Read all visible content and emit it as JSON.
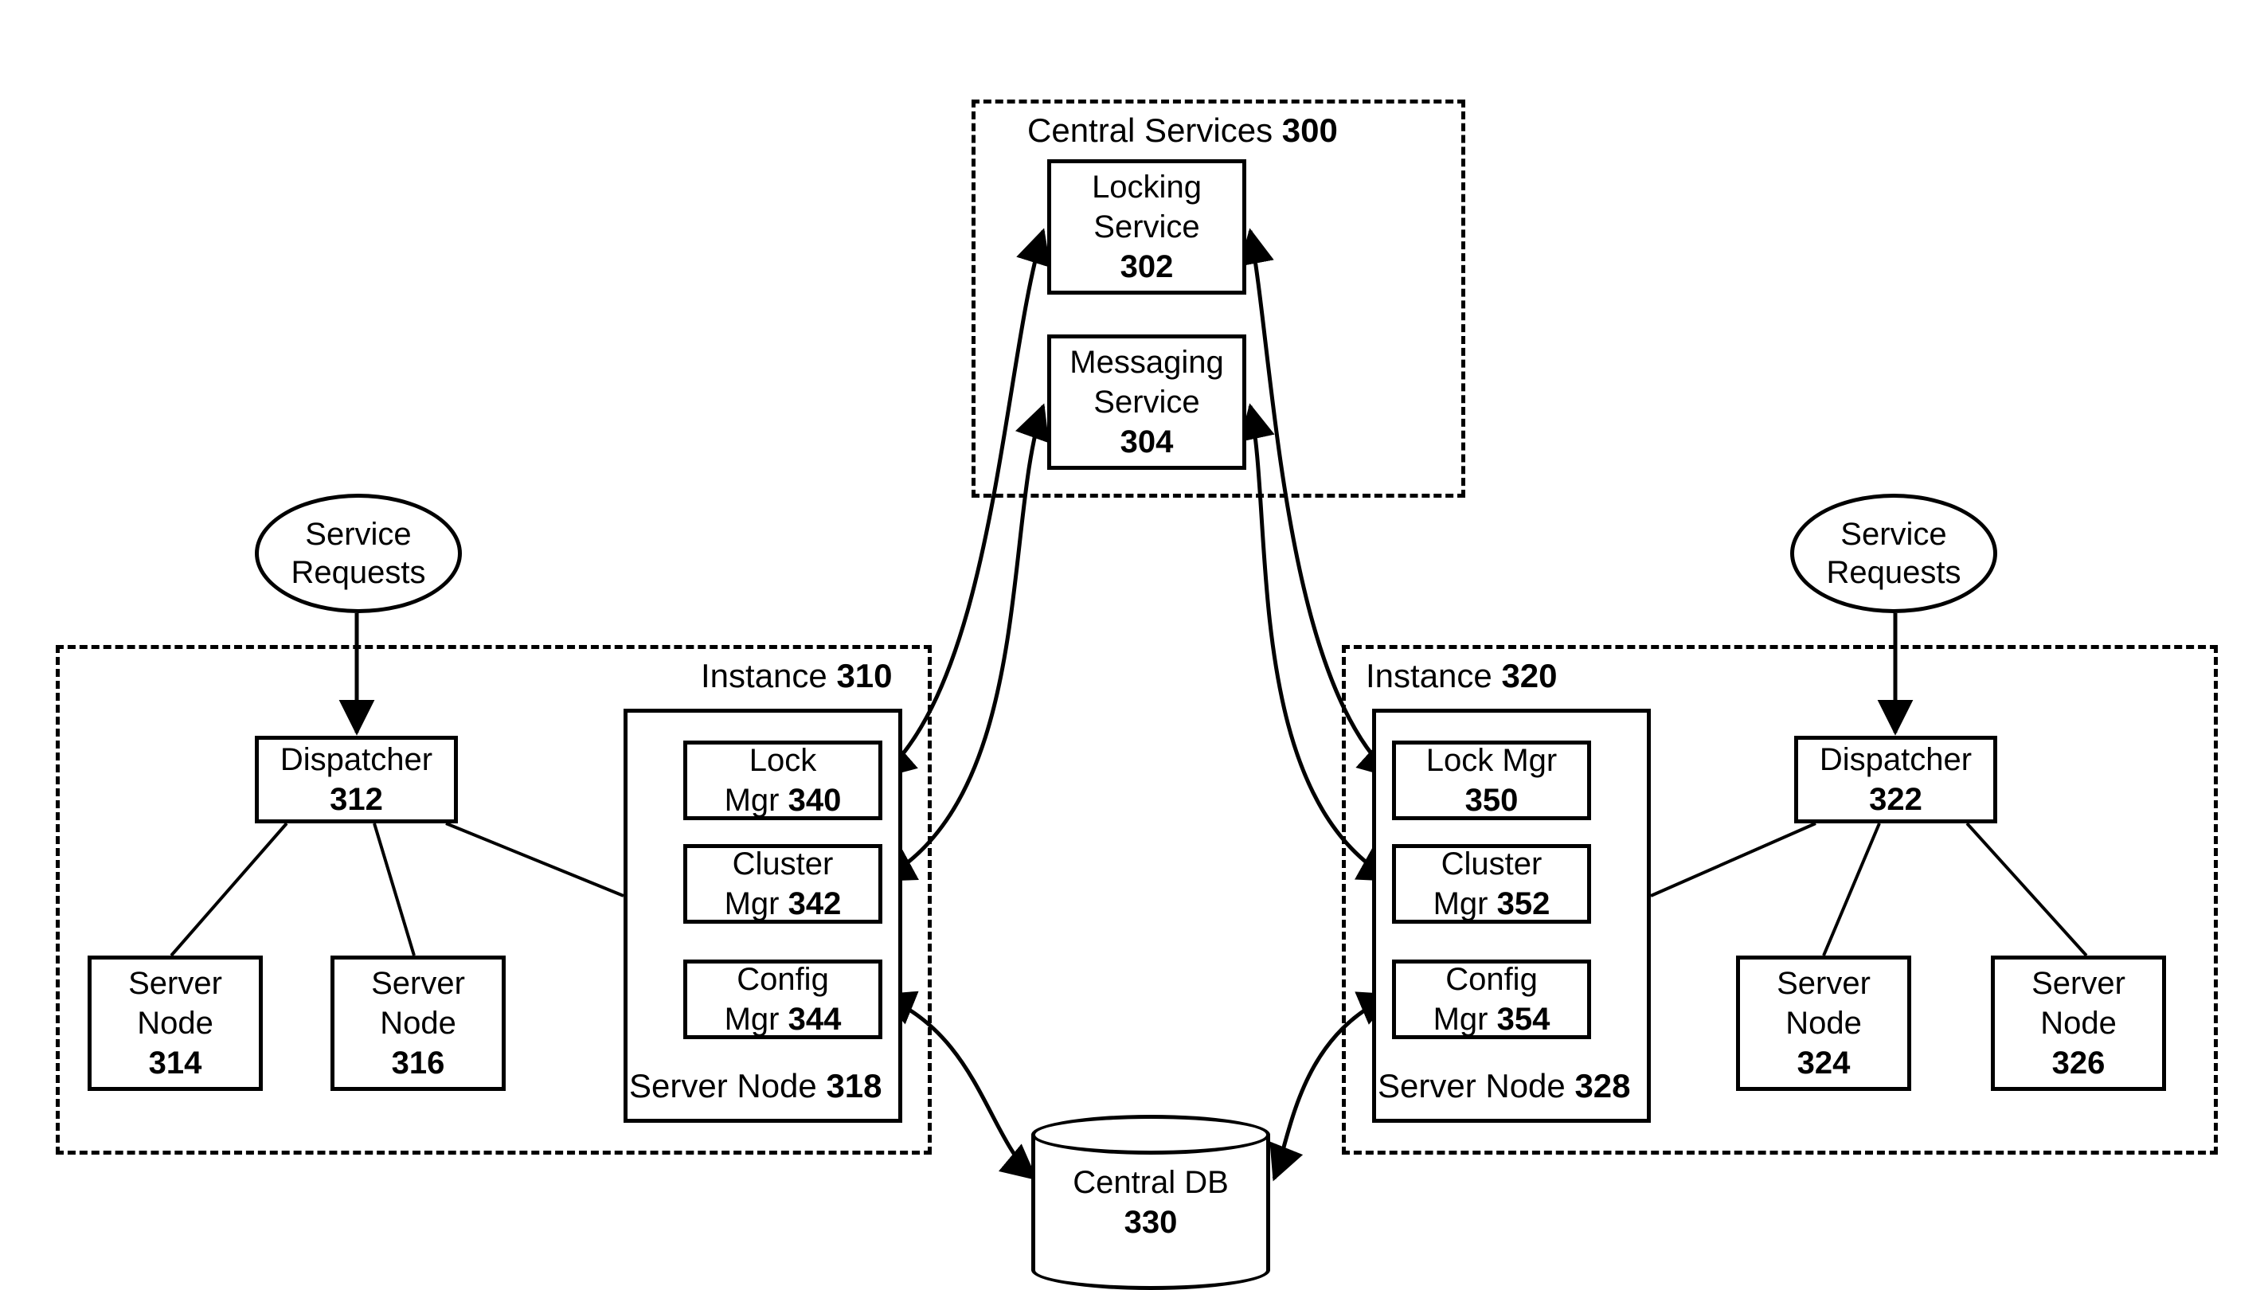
{
  "central": {
    "title_label": "Central Services",
    "title_num": "300",
    "locking": {
      "l1": "Locking",
      "l2": "Service",
      "num": "302"
    },
    "messaging": {
      "l1": "Messaging",
      "l2": "Service",
      "num": "304"
    }
  },
  "left": {
    "instance_label": "Instance",
    "instance_num": "310",
    "requests_l1": "Service",
    "requests_l2": "Requests",
    "dispatcher": {
      "label": "Dispatcher",
      "num": "312"
    },
    "sn1": {
      "l1": "Server",
      "l2": "Node",
      "num": "314"
    },
    "sn2": {
      "l1": "Server",
      "l2": "Node",
      "num": "316"
    },
    "sn_mgr_title_label": "Server Node",
    "sn_mgr_title_num": "318",
    "lock": {
      "l1": "Lock",
      "l2_label": "Mgr",
      "l2_num": "340"
    },
    "cluster": {
      "l1": "Cluster",
      "l2_label": "Mgr",
      "l2_num": "342"
    },
    "config": {
      "l1": "Config",
      "l2_label": "Mgr",
      "l2_num": "344"
    }
  },
  "right": {
    "instance_label": "Instance",
    "instance_num": "320",
    "requests_l1": "Service",
    "requests_l2": "Requests",
    "dispatcher": {
      "label": "Dispatcher",
      "num": "322"
    },
    "sn1": {
      "l1": "Server",
      "l2": "Node",
      "num": "324"
    },
    "sn2": {
      "l1": "Server",
      "l2": "Node",
      "num": "326"
    },
    "sn_mgr_title_label": "Server Node",
    "sn_mgr_title_num": "328",
    "lock": {
      "l1": "Lock Mgr",
      "num": "350"
    },
    "cluster": {
      "l1": "Cluster",
      "l2_label": "Mgr",
      "l2_num": "352"
    },
    "config": {
      "l1": "Config",
      "l2_label": "Mgr",
      "l2_num": "354"
    }
  },
  "db": {
    "label": "Central DB",
    "num": "330"
  }
}
